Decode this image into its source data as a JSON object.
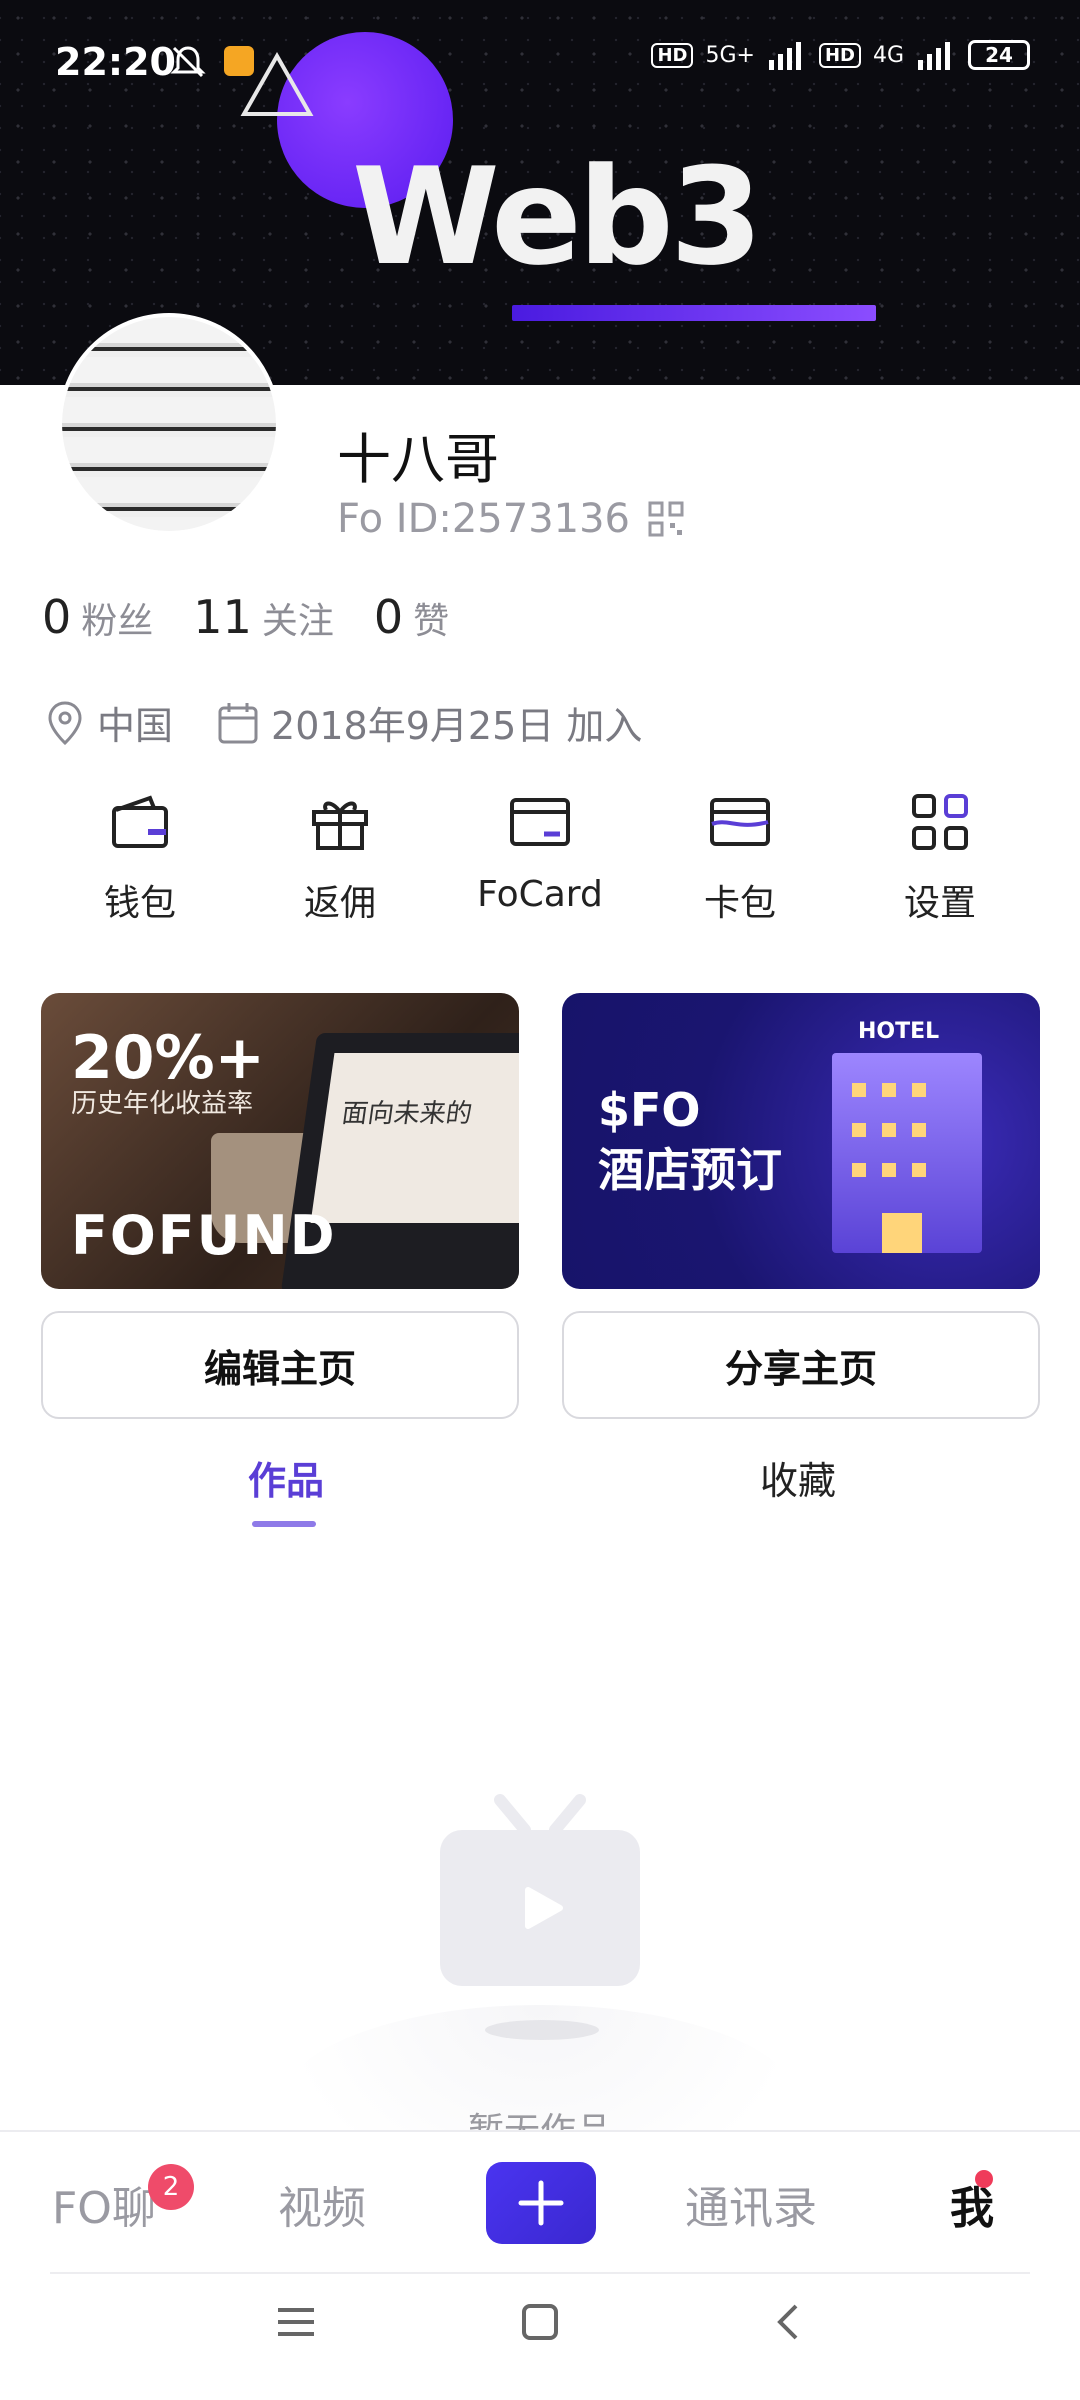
{
  "status_bar": {
    "time": "22:20",
    "network1": "5G+",
    "network2": "4G",
    "hd": "HD",
    "battery": "24"
  },
  "banner": {
    "title": "Web3"
  },
  "profile": {
    "name": "十八哥",
    "fo_id": "Fo ID:2573136"
  },
  "stats": [
    {
      "num": "0",
      "label": "粉丝"
    },
    {
      "num": "11",
      "label": "关注"
    },
    {
      "num": "0",
      "label": "赞"
    }
  ],
  "meta": {
    "location": "中国",
    "joined": "2018年9月25日 加入"
  },
  "actions": [
    {
      "label": "钱包",
      "icon": "wallet-icon"
    },
    {
      "label": "返佣",
      "icon": "gift-icon"
    },
    {
      "label": "FoCard",
      "icon": "card-icon"
    },
    {
      "label": "卡包",
      "icon": "cardholder-icon"
    },
    {
      "label": "设置",
      "icon": "grid-icon"
    }
  ],
  "promos": {
    "left": {
      "big": "20%+",
      "sub": "历史年化收益率",
      "brand": "FOFUND",
      "screen": "面向未来的"
    },
    "right": {
      "line1": "$FO",
      "line2": "酒店预订",
      "sign": "HOTEL"
    }
  },
  "buttons": {
    "edit": "编辑主页",
    "share": "分享主页"
  },
  "tabs": {
    "works": "作品",
    "favorites": "收藏"
  },
  "empty": {
    "text": "暂无作品"
  },
  "bottom_nav": {
    "fo": "FO聊",
    "fo_badge": "2",
    "video": "视频",
    "contacts": "通讯录",
    "me": "我"
  },
  "colors": {
    "accent": "#5a3ed6",
    "plus_button": "#4a34f0",
    "badge": "#ef4b6a"
  }
}
